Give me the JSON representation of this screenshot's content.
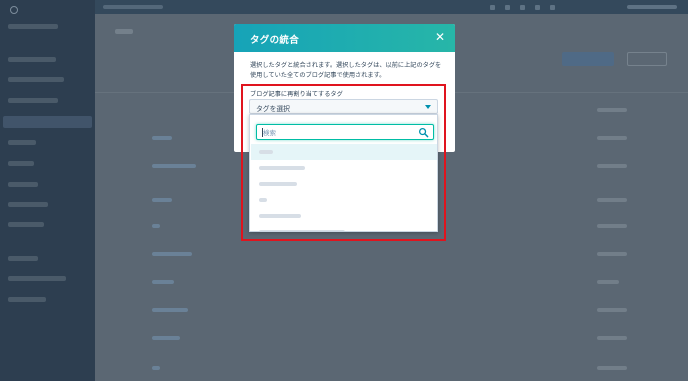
{
  "modal": {
    "title": "タグの統合",
    "close_icon": "close-icon",
    "description": "選択したタグと統合されます。選択したタグは、以前に上記のタグを使用していた全てのブログ記事で使用されます。"
  },
  "merge_field": {
    "label": "ブログ記事に再割り当てするタグ",
    "selected_value": "タグを選択",
    "caret_icon": "caret-down-icon"
  },
  "dropdown": {
    "search_placeholder": "検索",
    "search_icon": "search-icon",
    "options_count_visible": 6
  },
  "colors": {
    "modal_header_start": "#16a3b8",
    "modal_header_end": "#27b6a8",
    "search_focus_border": "#00bda5",
    "highlight_box": "#e0141e",
    "overlay_background": "#56636f"
  }
}
